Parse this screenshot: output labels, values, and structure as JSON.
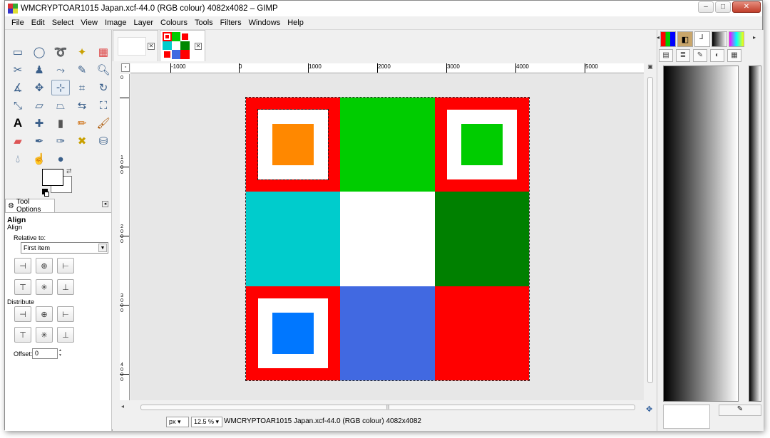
{
  "window": {
    "title": "WMCRYPTOAR1015 Japan.xcf-44.0 (RGB colour) 4082x4082 – GIMP",
    "controls": {
      "minimize": "–",
      "maximize": "□",
      "close": "✕"
    }
  },
  "menubar": [
    "File",
    "Edit",
    "Select",
    "View",
    "Image",
    "Layer",
    "Colours",
    "Tools",
    "Filters",
    "Windows",
    "Help"
  ],
  "toolbox": {
    "tools": [
      "rect-select",
      "ellipse-select",
      "free-select",
      "fuzzy-select",
      "select-by-color",
      "scissors",
      "foreground-select",
      "paths",
      "color-picker",
      "zoom",
      "measure",
      "move",
      "align",
      "crop",
      "rotate",
      "scale",
      "shear",
      "perspective",
      "flip",
      "cage",
      "text",
      "heal",
      "blend",
      "pencil",
      "paintbrush",
      "eraser",
      "airbrush",
      "ink",
      "clone",
      "smudge",
      "dodge",
      "burn"
    ],
    "selected_tool": "align",
    "fg_color": "#ffffff",
    "bg_color": "#ffffff"
  },
  "tool_options": {
    "tab_label": "Tool Options",
    "title": "Align",
    "subtitle": "Align",
    "relative_label": "Relative to:",
    "relative_value": "First item",
    "distribute_label": "Distribute",
    "offset_label": "Offset:",
    "offset_value": "0"
  },
  "rulers": {
    "h_labels": [
      "-1000",
      "0",
      "1000",
      "2000",
      "3000",
      "4000",
      "5000"
    ],
    "v_labels": [
      "0",
      "1000",
      "2000",
      "3000",
      "4000"
    ]
  },
  "image": {
    "grid": [
      {
        "bg": "#ff0000",
        "frame": true,
        "inner": "#ff8800",
        "selected": true
      },
      {
        "bg": "#00cc00",
        "frame": false
      },
      {
        "bg": "#ff0000",
        "frame": true,
        "inner": "#00cc00"
      },
      {
        "bg": "#00cccc",
        "frame": false
      },
      {
        "bg": "#ffffff",
        "frame": false
      },
      {
        "bg": "#008000",
        "frame": false
      },
      {
        "bg": "#ff0000",
        "frame": true,
        "inner": "#0077ff"
      },
      {
        "bg": "#4169e1",
        "frame": false
      },
      {
        "bg": "#ff0000",
        "frame": false
      }
    ]
  },
  "statusbar": {
    "unit": "px",
    "zoom": "12.5 %",
    "text": "WMCRYPTOAR1015 Japan.xcf-44.0 (RGB colour) 4082x4082"
  }
}
